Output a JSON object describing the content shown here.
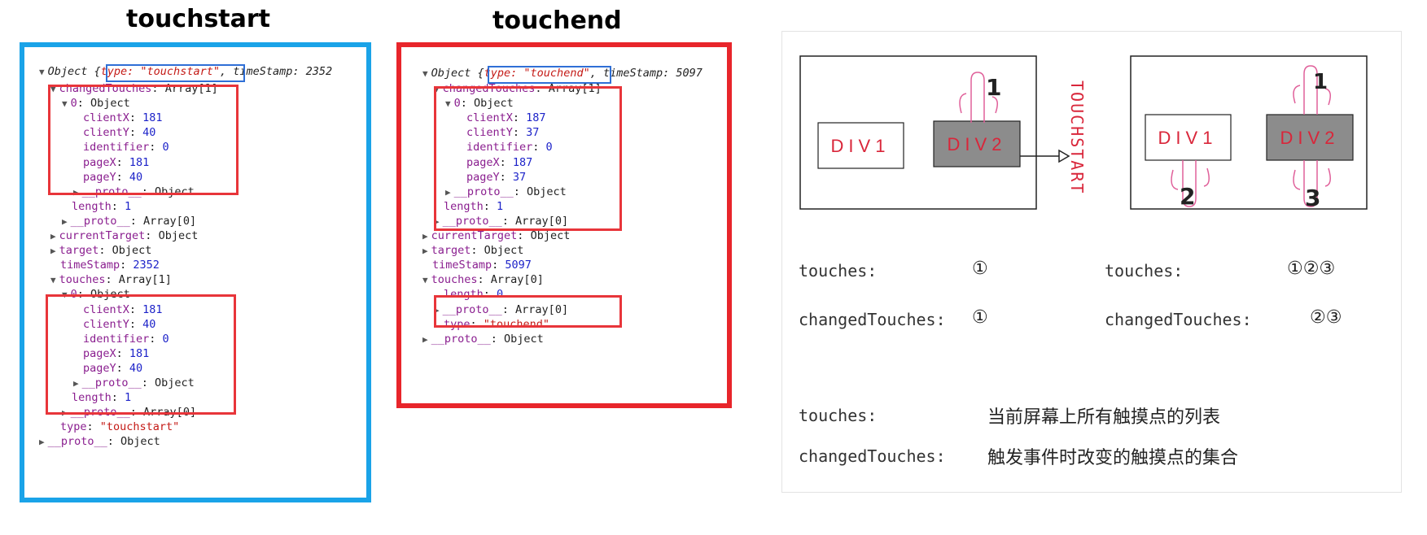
{
  "panels": {
    "touchstart_title": "touchstart",
    "touchend_title": "touchend"
  },
  "touchstart": {
    "header_prefix": "Object {",
    "header_type": "type: \"touchstart\"",
    "header_rest": ", timeStamp: 2352",
    "lines": [
      {
        "indent": 1,
        "tri": "▼",
        "key": "changedTouches",
        "sep": ": ",
        "val": "Array[1]",
        "cls": "plain"
      },
      {
        "indent": 2,
        "tri": "▼",
        "key": "0",
        "sep": ": ",
        "val": "Object",
        "cls": "plain"
      },
      {
        "indent": 3,
        "tri": "",
        "key": "clientX",
        "sep": ": ",
        "val": "181",
        "cls": "num"
      },
      {
        "indent": 3,
        "tri": "",
        "key": "clientY",
        "sep": ": ",
        "val": "40",
        "cls": "num"
      },
      {
        "indent": 3,
        "tri": "",
        "key": "identifier",
        "sep": ": ",
        "val": "0",
        "cls": "num"
      },
      {
        "indent": 3,
        "tri": "",
        "key": "pageX",
        "sep": ": ",
        "val": "181",
        "cls": "num"
      },
      {
        "indent": 3,
        "tri": "",
        "key": "pageY",
        "sep": ": ",
        "val": "40",
        "cls": "num"
      },
      {
        "indent": 3,
        "tri": "▶",
        "key": "__proto__",
        "sep": ": ",
        "val": "Object",
        "cls": "plain"
      },
      {
        "indent": 2,
        "tri": "",
        "key": "length",
        "sep": ": ",
        "val": "1",
        "cls": "num"
      },
      {
        "indent": 2,
        "tri": "▶",
        "key": "__proto__",
        "sep": ": ",
        "val": "Array[0]",
        "cls": "plain"
      },
      {
        "indent": 1,
        "tri": "▶",
        "key": "currentTarget",
        "sep": ": ",
        "val": "Object",
        "cls": "plain"
      },
      {
        "indent": 1,
        "tri": "▶",
        "key": "target",
        "sep": ": ",
        "val": "Object",
        "cls": "plain"
      },
      {
        "indent": 1,
        "tri": "",
        "key": "timeStamp",
        "sep": ": ",
        "val": "2352",
        "cls": "num"
      },
      {
        "indent": 1,
        "tri": "▼",
        "key": "touches",
        "sep": ": ",
        "val": "Array[1]",
        "cls": "plain"
      },
      {
        "indent": 2,
        "tri": "▼",
        "key": "0",
        "sep": ": ",
        "val": "Object",
        "cls": "plain"
      },
      {
        "indent": 3,
        "tri": "",
        "key": "clientX",
        "sep": ": ",
        "val": "181",
        "cls": "num"
      },
      {
        "indent": 3,
        "tri": "",
        "key": "clientY",
        "sep": ": ",
        "val": "40",
        "cls": "num"
      },
      {
        "indent": 3,
        "tri": "",
        "key": "identifier",
        "sep": ": ",
        "val": "0",
        "cls": "num"
      },
      {
        "indent": 3,
        "tri": "",
        "key": "pageX",
        "sep": ": ",
        "val": "181",
        "cls": "num"
      },
      {
        "indent": 3,
        "tri": "",
        "key": "pageY",
        "sep": ": ",
        "val": "40",
        "cls": "num"
      },
      {
        "indent": 3,
        "tri": "▶",
        "key": "__proto__",
        "sep": ": ",
        "val": "Object",
        "cls": "plain"
      },
      {
        "indent": 2,
        "tri": "",
        "key": "length",
        "sep": ": ",
        "val": "1",
        "cls": "num"
      },
      {
        "indent": 2,
        "tri": "▶",
        "key": "__proto__",
        "sep": ": ",
        "val": "Array[0]",
        "cls": "plain"
      },
      {
        "indent": 1,
        "tri": "",
        "key": "type",
        "sep": ": ",
        "val": "\"touchstart\"",
        "cls": "str"
      },
      {
        "indent": 0,
        "tri": "▶",
        "key": "__proto__",
        "sep": ": ",
        "val": "Object",
        "cls": "plain"
      }
    ]
  },
  "touchend": {
    "header_prefix": "Object {",
    "header_type": "type: \"touchend\"",
    "header_rest": ", timeStamp: 5097",
    "lines": [
      {
        "indent": 1,
        "tri": "▼",
        "key": "changedTouches",
        "sep": ": ",
        "val": "Array[1]",
        "cls": "plain"
      },
      {
        "indent": 2,
        "tri": "▼",
        "key": "0",
        "sep": ": ",
        "val": "Object",
        "cls": "plain"
      },
      {
        "indent": 3,
        "tri": "",
        "key": "clientX",
        "sep": ": ",
        "val": "187",
        "cls": "num"
      },
      {
        "indent": 3,
        "tri": "",
        "key": "clientY",
        "sep": ": ",
        "val": "37",
        "cls": "num"
      },
      {
        "indent": 3,
        "tri": "",
        "key": "identifier",
        "sep": ": ",
        "val": "0",
        "cls": "num"
      },
      {
        "indent": 3,
        "tri": "",
        "key": "pageX",
        "sep": ": ",
        "val": "187",
        "cls": "num"
      },
      {
        "indent": 3,
        "tri": "",
        "key": "pageY",
        "sep": ": ",
        "val": "37",
        "cls": "num"
      },
      {
        "indent": 2,
        "tri": "▶",
        "key": "__proto__",
        "sep": ": ",
        "val": "Object",
        "cls": "plain"
      },
      {
        "indent": 1,
        "tri": "",
        "key": "length",
        "sep": ": ",
        "val": "1",
        "cls": "num"
      },
      {
        "indent": 1,
        "tri": "▶",
        "key": "__proto__",
        "sep": ": ",
        "val": "Array[0]",
        "cls": "plain"
      },
      {
        "indent": 0,
        "tri": "▶",
        "key": "currentTarget",
        "sep": ": ",
        "val": "Object",
        "cls": "plain"
      },
      {
        "indent": 0,
        "tri": "▶",
        "key": "target",
        "sep": ": ",
        "val": "Object",
        "cls": "plain"
      },
      {
        "indent": 0,
        "tri": "",
        "key": "timeStamp",
        "sep": ": ",
        "val": "5097",
        "cls": "num"
      },
      {
        "indent": 0,
        "tri": "▼",
        "key": "touches",
        "sep": ": ",
        "val": "Array[0]",
        "cls": "plain"
      },
      {
        "indent": 1,
        "tri": "",
        "key": "length",
        "sep": ": ",
        "val": "0",
        "cls": "num"
      },
      {
        "indent": 1,
        "tri": "▶",
        "key": "__proto__",
        "sep": ": ",
        "val": "Array[0]",
        "cls": "plain"
      },
      {
        "indent": 1,
        "tri": "",
        "key": "type",
        "sep": ": ",
        "val": "\"touchend\"",
        "cls": "str"
      },
      {
        "indent": 0,
        "tri": "▶",
        "key": "__proto__",
        "sep": ": ",
        "val": "Object",
        "cls": "plain"
      }
    ]
  },
  "diagram": {
    "div1_label": "DIV1",
    "div2_label": "DIV2",
    "event_label": "TOUCHSTART",
    "finger_1": "1",
    "finger_2": "2",
    "finger_3": "3",
    "left_touches_label": "touches:",
    "left_touches_val": "①",
    "left_changed_label": "changedTouches:",
    "left_changed_val": "①",
    "right_touches_label": "touches:",
    "right_touches_val": "①②③",
    "right_changed_label": "changedTouches:",
    "right_changed_val": "②③",
    "def_touches_label": "touches:",
    "def_touches_text": "当前屏幕上所有触摸点的列表",
    "def_changed_label": "changedTouches:",
    "def_changed_text": "触发事件时改变的触摸点的集合"
  },
  "colors": {
    "blue_frame": "#1aa3e8",
    "red_frame": "#e8252b",
    "highlight_red": "#e8353a",
    "highlight_blue": "#2f6fd6",
    "div_label": "#d9263a"
  }
}
